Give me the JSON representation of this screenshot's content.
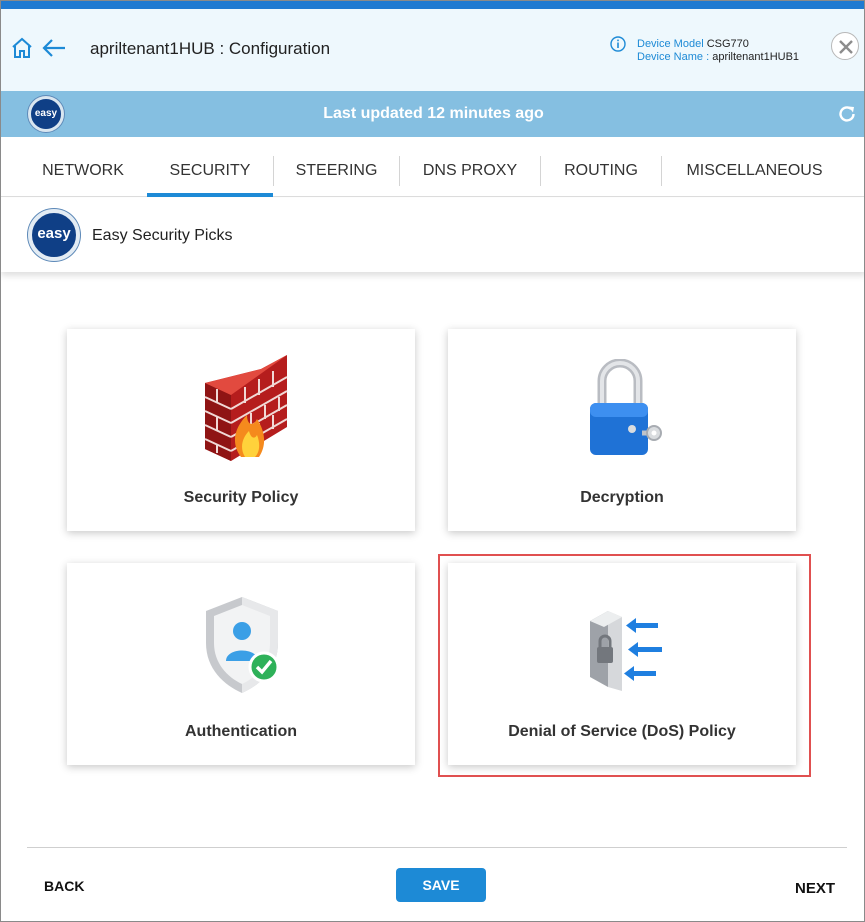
{
  "header": {
    "title": "apriltenant1HUB : Configuration",
    "device_model_key": "Device Model",
    "device_model_value": "CSG770",
    "device_name_key": "Device Name :",
    "device_name_value": "apriltenant1HUB1"
  },
  "status": {
    "badge": "easy",
    "text": "Last updated 12 minutes ago"
  },
  "tabs": [
    {
      "label": "NETWORK"
    },
    {
      "label": "SECURITY"
    },
    {
      "label": "STEERING"
    },
    {
      "label": "DNS PROXY"
    },
    {
      "label": "ROUTING"
    },
    {
      "label": "MISCELLANEOUS"
    }
  ],
  "subheader": {
    "badge": "easy",
    "title": "Easy Security Picks"
  },
  "cards": [
    {
      "label": "Security Policy",
      "icon": "firewall-icon"
    },
    {
      "label": "Decryption",
      "icon": "padlock-icon"
    },
    {
      "label": "Authentication",
      "icon": "user-shield-icon"
    },
    {
      "label": "Denial of Service (DoS) Policy",
      "icon": "dos-shield-icon"
    }
  ],
  "footer": {
    "back": "BACK",
    "save": "SAVE",
    "next": "NEXT"
  },
  "colors": {
    "accent": "#1d8ad6",
    "header_bg": "#eef8fd",
    "status_bg": "#85bfe1",
    "selection": "#e05050"
  }
}
